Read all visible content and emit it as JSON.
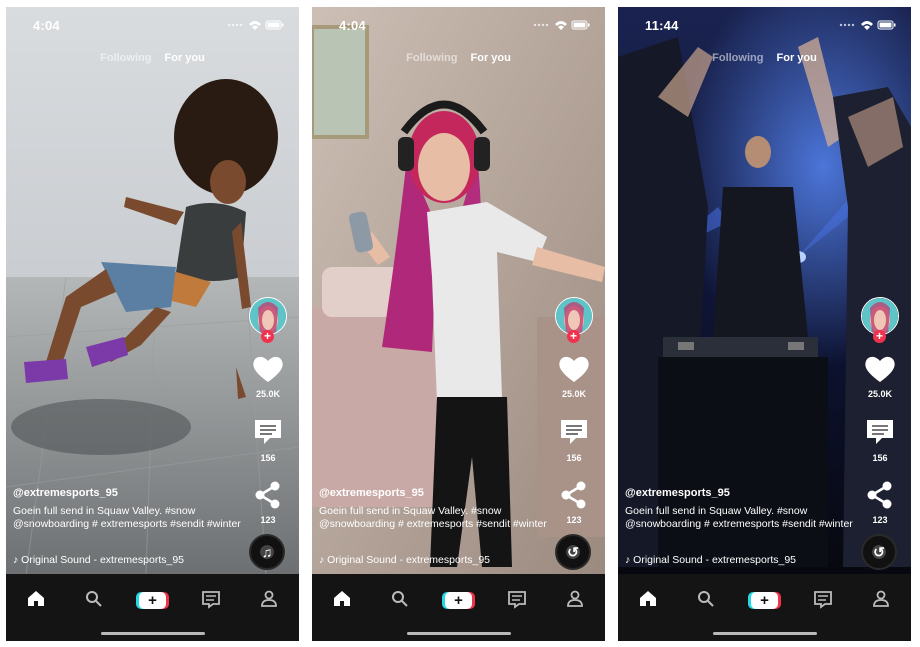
{
  "phones": [
    {
      "status": {
        "time": "4:04"
      },
      "tabs": {
        "following": "Following",
        "for_you": "For you"
      },
      "actions": {
        "likes": "25.0K",
        "comments": "156",
        "shares": "123"
      },
      "post": {
        "username": "@extremesports_95",
        "caption": "Goein full send in Squaw Valley. #snow @snowboarding # extremesports #sendit #winter",
        "sound": "Original Sound - extremesports_95"
      }
    },
    {
      "status": {
        "time": "4:04"
      },
      "tabs": {
        "following": "Following",
        "for_you": "For you"
      },
      "actions": {
        "likes": "25.0K",
        "comments": "156",
        "shares": "123"
      },
      "post": {
        "username": "@extremesports_95",
        "caption": "Goein full send in Squaw Valley. #snow @snowboarding # extremesports #sendit #winter",
        "sound": "Original Sound - extremesports_95"
      }
    },
    {
      "status": {
        "time": "11:44"
      },
      "tabs": {
        "following": "Following",
        "for_you": "For you"
      },
      "actions": {
        "likes": "25.0K",
        "comments": "156",
        "shares": "123"
      },
      "post": {
        "username": "@extremesports_95",
        "caption": "Goein full send in Squaw Valley. #snow @snowboarding # extremesports #sendit #winter",
        "sound": "Original Sound - extremesports_95"
      }
    }
  ],
  "icons": {
    "tabbar": [
      "home-icon",
      "search-icon",
      "create-icon",
      "inbox-icon",
      "profile-icon"
    ],
    "rail": [
      "avatar",
      "heart-icon",
      "comment-icon",
      "share-icon",
      "music-disc-icon"
    ]
  },
  "colors": {
    "accent_red": "#f0334d",
    "accent_cyan": "#25d8e6",
    "tabbar_bg": "#141414"
  }
}
